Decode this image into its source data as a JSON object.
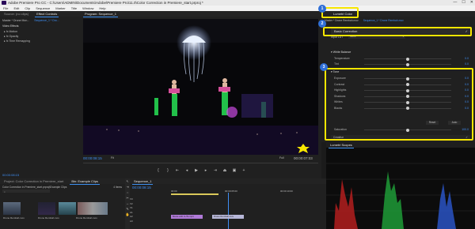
{
  "window": {
    "title": "Adobe Premiere Pro CC - C:\\Users\\ADMIN\\Documents\\Adobe\\Premiere Pro\\11.0\\Color Correction in Premiere_start.prproj *",
    "min": "—",
    "max": "☐",
    "close": "✕"
  },
  "menu": [
    "File",
    "Edit",
    "Clip",
    "Sequence",
    "Marker",
    "Title",
    "Window",
    "Help"
  ],
  "left_panel": {
    "tabs": [
      "Source: (no clips)",
      "Effect Controls",
      "Audio Clip Mixer"
    ],
    "header": [
      "Master * Drone Mon...",
      "Sequence_1 * Dro..."
    ],
    "section": "Video Effects",
    "items": [
      {
        "label": "Motion",
        "icon": "fx-icon"
      },
      {
        "label": "Opacity",
        "icon": "fx-icon"
      },
      {
        "label": "Time Remapping",
        "icon": "fx-icon"
      }
    ],
    "timecode": "00:00:08:15"
  },
  "program": {
    "tab": "Program: Sequence_1",
    "timecode": "00:00:08:15",
    "fit": "Fit",
    "quality": "Full",
    "duration": "00:00:07:03"
  },
  "lumetri": {
    "tab": "Lumetri Color",
    "header": [
      "Master * Drone Rembah.mov",
      "Sequence_1 * Drone Rembah.mov"
    ],
    "basic_correction": "Basic Correction",
    "input_lut_label": "Input LUT",
    "input_lut_value": "None",
    "white_balance": "White Balance",
    "wb_rows": [
      {
        "label": "Temperature",
        "value": "0.0",
        "pos": 0.5
      },
      {
        "label": "Tint",
        "value": "0.0",
        "pos": 0.5
      }
    ],
    "tone": "Tone",
    "tone_rows": [
      {
        "label": "Exposure",
        "value": "0.0",
        "pos": 0.5
      },
      {
        "label": "Contrast",
        "value": "0.0",
        "pos": 0.5
      },
      {
        "label": "Highlights",
        "value": "0.0",
        "pos": 0.5
      },
      {
        "label": "Shadows",
        "value": "0.0",
        "pos": 0.5
      },
      {
        "label": "Whites",
        "value": "0.0",
        "pos": 0.5
      },
      {
        "label": "Blacks",
        "value": "0.0",
        "pos": 0.5
      }
    ],
    "reset": "Reset",
    "auto": "Auto",
    "saturation_label": "Saturation",
    "saturation_value": "100.0",
    "creative": "Creative",
    "markers": [
      "1",
      "2",
      "3"
    ]
  },
  "scopes": {
    "tab": "Lumetri Scopes"
  },
  "project": {
    "tabs": [
      "Project: Color Correction in Premiere_start",
      "Bin: Example Clips"
    ],
    "path": "Color Correction in Premiere_start.prproj\\Example Clips",
    "count": "4 Items",
    "clips": [
      {
        "name": "Drone Rembah.mov",
        "dur": "16:13"
      },
      {
        "name": "Drone Rembah.mov",
        "dur": "19:23"
      },
      {
        "name": "Drone Rembah.mov",
        "dur": "12:10"
      },
      {
        "name": "Drone Rembah.mov",
        "dur": "16:06"
      }
    ]
  },
  "timeline": {
    "tab": "Sequence_1",
    "timecode": "00:00:08:15",
    "ruler": [
      "00:00",
      "00:00:05:00",
      "00:00:10:00"
    ],
    "tracks": [
      "V3",
      "V2",
      "V1",
      "A1",
      "A2",
      "A3"
    ],
    "clips": [
      "Movie with LUTs.mp4",
      "Drone Rembah.mov"
    ]
  }
}
